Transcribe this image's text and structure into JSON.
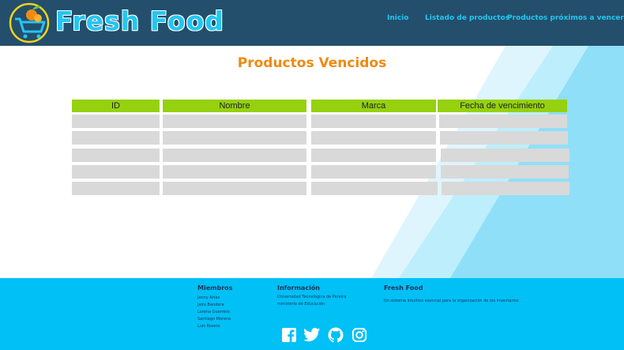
{
  "header": {
    "brand": "Fresh Food",
    "nav": [
      "Inicio",
      "Listado de productos",
      "Productos próximos a vencerse"
    ]
  },
  "main": {
    "title": "Productos Vencidos",
    "table": {
      "columns": [
        "ID",
        "Nombre",
        "Marca",
        "Fecha de vencimiento"
      ],
      "row_count": 5
    }
  },
  "footer": {
    "members": {
      "heading": "Miembros",
      "names": [
        "Jenny Arias",
        "Jairo Bandera",
        "Lorena Guerrero",
        "Santiago Moreno",
        "Luis Rosero"
      ]
    },
    "info": {
      "heading": "Información",
      "lines": [
        "Universidad Tecnologica de Pereira",
        "ministerio de Educación"
      ]
    },
    "about": {
      "heading": "Fresh Food",
      "text": "Un sistema intuitivo esencial para la organización de los inventarios"
    },
    "social_icons": [
      "facebook-icon",
      "twitter-icon",
      "github-icon",
      "instagram-icon"
    ]
  },
  "colors": {
    "header_bg": "#234f6c",
    "brand_blue": "#23c6f2",
    "title_orange": "#f08a12",
    "table_header_green": "#95d10f",
    "cell_gray": "#d9d9d9",
    "footer_bg": "#00c0f6"
  }
}
